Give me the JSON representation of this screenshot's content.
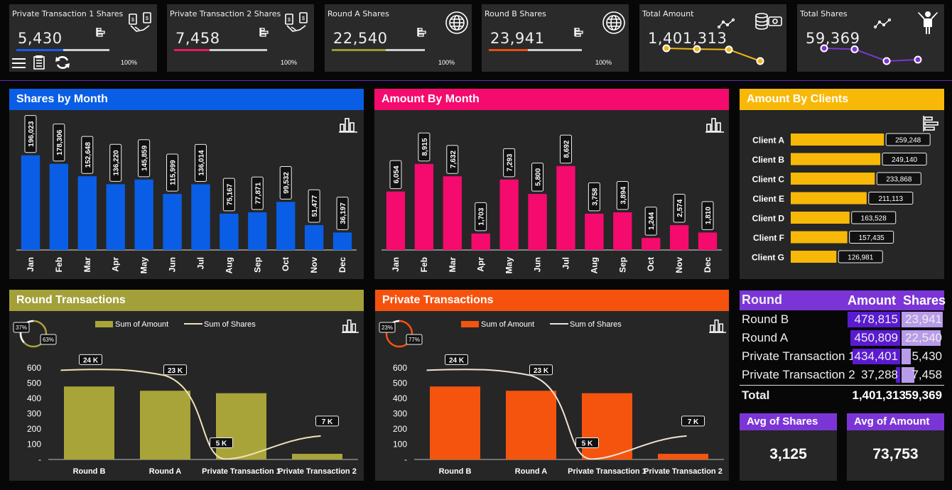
{
  "kpis": [
    {
      "title": "Private Transaction 1 Shares",
      "value": "5,430",
      "pct": "100%",
      "color": "#1a5cf0",
      "progress": 0.5
    },
    {
      "title": "Private Transaction 2 Shares",
      "value": "7,458",
      "pct": "100%",
      "color": "#e8185f",
      "progress": 0.38
    },
    {
      "title": "Round A Shares",
      "value": "22,540",
      "pct": "100%",
      "color": "#9a9a2e",
      "progress": 0.58
    },
    {
      "title": "Round B Shares",
      "value": "23,941",
      "pct": "100%",
      "color": "#e84e12",
      "progress": 0.42
    },
    {
      "title": "Total Amount",
      "value": "1,401,313",
      "spark": [
        478815,
        450809,
        434401,
        37288
      ],
      "color": "#f2b51a"
    },
    {
      "title": "Total Shares",
      "value": "59,369",
      "spark": [
        23941,
        22540,
        5430,
        7458
      ],
      "color": "#7b35d6"
    }
  ],
  "icons": {
    "menu": "menu-icon",
    "report": "report-icon",
    "refresh": "refresh-icon"
  },
  "shares_by_month": {
    "title": "Shares by Month",
    "color": "#0a5ee6",
    "header_color": "#0a5ee6",
    "chart_data": {
      "type": "bar",
      "categories": [
        "Jan",
        "Feb",
        "Mar",
        "Apr",
        "May",
        "Jun",
        "Jul",
        "Aug",
        "Sep",
        "Oct",
        "Nov",
        "Dec"
      ],
      "values": [
        196023,
        178306,
        152648,
        136220,
        145859,
        115999,
        136014,
        75167,
        77871,
        99532,
        51477,
        36197
      ],
      "labels": [
        "196,023",
        "178,306",
        "152,648",
        "136,220",
        "145,859",
        "115,999",
        "136,014",
        "75,167",
        "77,871",
        "99,532",
        "51,477",
        "36,197"
      ],
      "ylim": [
        0,
        250000
      ]
    }
  },
  "amount_by_month": {
    "title": "Amount By Month",
    "color": "#f50a6e",
    "header_color": "#f50a6e",
    "chart_data": {
      "type": "bar",
      "categories": [
        "Jan",
        "Feb",
        "Mar",
        "Apr",
        "May",
        "Jun",
        "Jul",
        "Aug",
        "Sep",
        "Oct",
        "Nov",
        "Dec"
      ],
      "values": [
        6054,
        8915,
        7632,
        1703,
        7293,
        5800,
        8692,
        3758,
        3894,
        1244,
        2574,
        1810
      ],
      "labels": [
        "6,054",
        "8,915",
        "7,632",
        "1,703",
        "7,293",
        "5,800",
        "8,692",
        "3,758",
        "3,894",
        "1,244",
        "2,574",
        "1,810"
      ],
      "ylim": [
        0,
        12500
      ]
    }
  },
  "amount_by_clients": {
    "title": "Amount By Clients",
    "color": "#f8b808",
    "header_color": "#f8b808",
    "chart_data": {
      "type": "bar",
      "orientation": "horizontal",
      "categories": [
        "Client A",
        "Client B",
        "Client C",
        "Client E",
        "Client D",
        "Client F",
        "Client G"
      ],
      "values": [
        259248,
        249140,
        233868,
        211113,
        163528,
        157435,
        126981
      ],
      "labels": [
        "259,248",
        "249,140",
        "233,868",
        "211,113",
        "163,528",
        "157,435",
        "126,981"
      ],
      "xlim": [
        0,
        330000
      ]
    }
  },
  "round_transactions": {
    "title": "Round Transactions",
    "header_color": "#a3a03a",
    "bar_color": "#a9a43a",
    "line_color": "#f1e2b6",
    "donut": {
      "a": "37%",
      "b": "63%",
      "a_color": "#ffffff",
      "b_color": "#a9a43a"
    },
    "legend": [
      "Sum of Amount",
      "Sum of Shares"
    ],
    "chart_data": {
      "type": "bar+line",
      "categories": [
        "Round B",
        "Round A",
        "Private Transaction 1",
        "Private Transaction 2"
      ],
      "series": [
        {
          "name": "Sum of Amount",
          "values": [
            478,
            450,
            434,
            37
          ]
        },
        {
          "name": "Sum of Shares",
          "values": [
            23941,
            22540,
            5430,
            7458
          ]
        }
      ],
      "line_labels": [
        "24 K",
        "23 K",
        "5 K",
        "7 K"
      ],
      "yticks": [
        "600",
        "500",
        "400",
        "300",
        "200",
        "100",
        "-"
      ],
      "ylim": [
        0,
        600
      ],
      "y2lim": [
        0,
        30000
      ]
    }
  },
  "private_transactions": {
    "title": "Private Transactions",
    "header_color": "#f5520e",
    "bar_color": "#f5540e",
    "line_color": "#f1e2d6",
    "donut": {
      "a": "23%",
      "b": "77%",
      "a_color": "#ffffff",
      "b_color": "#f5540e"
    },
    "legend": [
      "Sum of Amount",
      "Sum of Shares"
    ],
    "chart_data": {
      "type": "bar+line",
      "categories": [
        "Round B",
        "Round A",
        "Private Transaction 1",
        "Private Transaction 2"
      ],
      "series": [
        {
          "name": "Sum of Amount",
          "values": [
            478,
            450,
            434,
            37
          ]
        },
        {
          "name": "Sum of Shares",
          "values": [
            23941,
            22540,
            5430,
            7458
          ]
        }
      ],
      "line_labels": [
        "24 K",
        "23 K",
        "5 K",
        "7 K"
      ],
      "yticks": [
        "600",
        "500",
        "400",
        "300",
        "200",
        "100",
        "-"
      ],
      "ylim": [
        0,
        600
      ],
      "y2lim": [
        0,
        30000
      ]
    }
  },
  "summary_table": {
    "headers": [
      "Round",
      "Amount",
      "Shares"
    ],
    "rows": [
      {
        "round": "Round B",
        "amount": "478,815",
        "shares": "23,941",
        "a": 478815,
        "s": 23941
      },
      {
        "round": "Round A",
        "amount": "450,809",
        "shares": "22,540",
        "a": 450809,
        "s": 22540
      },
      {
        "round": "Private Transaction 1",
        "amount": "434,401",
        "shares": "5,430",
        "a": 434401,
        "s": 5430
      },
      {
        "round": "Private Transaction 2",
        "amount": "37,288",
        "shares": "7,458",
        "a": 37288,
        "s": 7458
      }
    ],
    "total": {
      "label": "Total",
      "amount": "1,401,313",
      "shares": "59,369"
    }
  },
  "avg_shares": {
    "label": "Avg of Shares",
    "value": "3,125"
  },
  "avg_amount": {
    "label": "Avg of Amount",
    "value": "73,753"
  }
}
